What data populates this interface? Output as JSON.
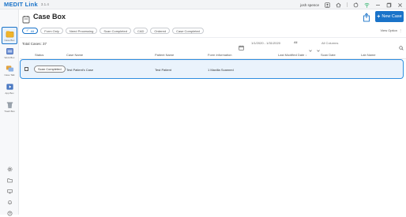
{
  "app": {
    "title": "MEDIT Link",
    "version": "3.1.4",
    "user": "josh spence"
  },
  "sidebar": {
    "items": [
      {
        "label": "Case Box",
        "icon": "case-box-icon"
      },
      {
        "label": "Work Box",
        "icon": "work-box-icon"
      },
      {
        "label": "Case Talk",
        "icon": "case-talk-icon"
      },
      {
        "label": "App Box",
        "icon": "app-box-icon"
      },
      {
        "label": "Trash Box",
        "icon": "trash-box-icon"
      }
    ],
    "bottom_icons": [
      "settings-icon",
      "folder-icon",
      "monitor-icon",
      "bell-icon",
      "help-icon"
    ]
  },
  "header": {
    "title": "Case Box",
    "new_case_label": "New Case"
  },
  "filters": {
    "chips": [
      "All",
      "Form Only",
      "Need Processing",
      "Scan Completed",
      "CAD",
      "Ordered",
      "Case Completed"
    ],
    "selected": "All",
    "view_option_label": "View Option"
  },
  "toolbar": {
    "total_label": "Total Cases: 37",
    "date_range": "1/1/2020 - 1/31/2020",
    "filter_value": "All",
    "search_placeholder": "All Columns"
  },
  "table": {
    "columns": [
      "Status",
      "Case Name",
      "Patient Name",
      "Form Information",
      "Last Modified Date ↓",
      "Scan Date",
      "Lab Name"
    ],
    "rows": [
      {
        "status": "Scan Completed",
        "case_name": "Test Patient's Case",
        "patient_name": "Test Patient",
        "form_information": "1 Maxilla Scanned",
        "last_modified": "",
        "scan_date": "",
        "lab_name": ""
      }
    ]
  },
  "colors": {
    "accent": "#1a73c9",
    "row_highlight": "#eaf3fc",
    "row_border": "#2f8ee0"
  }
}
